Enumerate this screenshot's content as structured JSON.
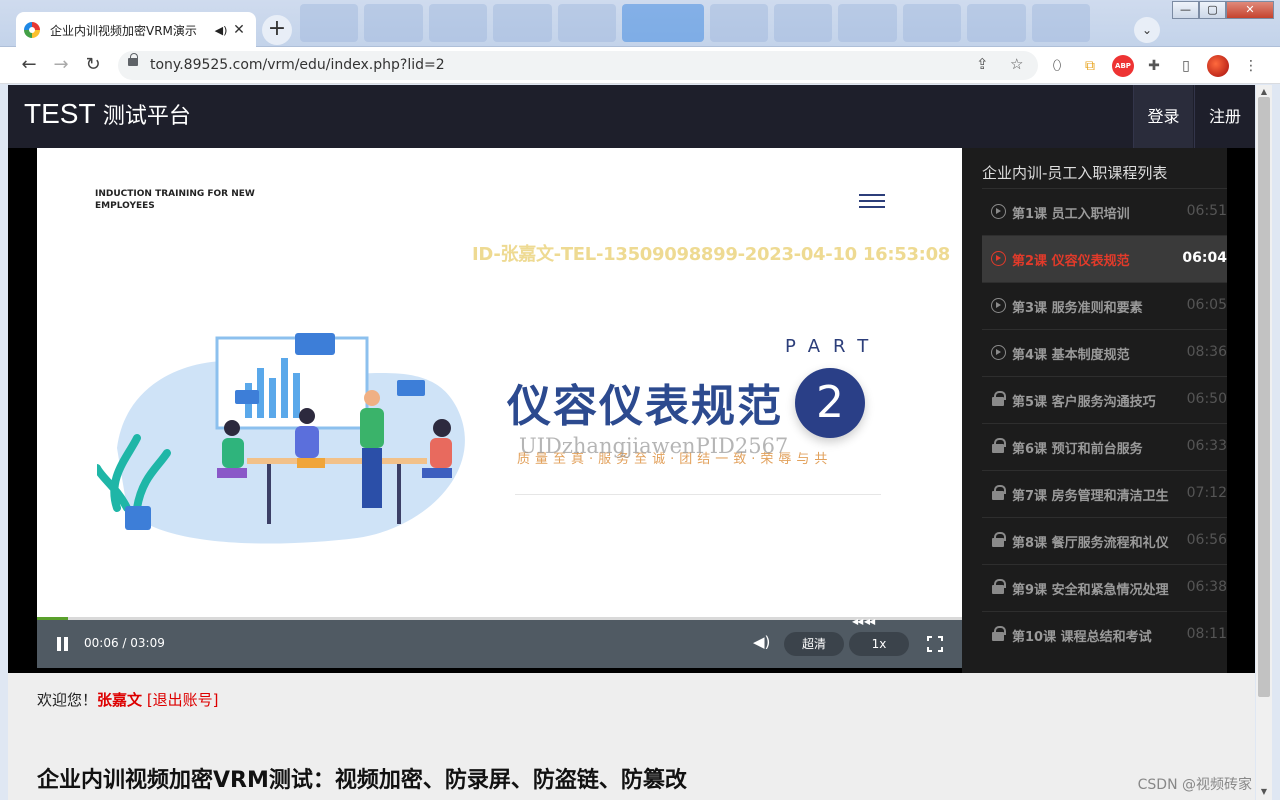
{
  "browser": {
    "tab_title": "企业内训视频加密VRM演示",
    "url": "tony.89525.com/vrm/edu/index.php?lid=2",
    "window_controls": [
      "—",
      "▢",
      "✕"
    ]
  },
  "site": {
    "logo_main": "TEST",
    "logo_sub": "测试平台",
    "login": "登录",
    "register": "注册"
  },
  "video": {
    "induction_text": "INDUCTION TRAINING FOR NEW EMPLOYEES",
    "watermark_top": "ID-张嘉文-TEL-13509098899-2023-04-10 16:53:08",
    "part_label": "PART",
    "slide_title": "仪容仪表规范",
    "part_number": "2",
    "watermark_mid": "UIDzhangjiawenPID2567",
    "motto": "质量至真·服务至诚·团结一致·荣辱与共",
    "progress_fraction": 0.033
  },
  "controls": {
    "time": "00:06 / 03:09",
    "quality": "超清",
    "speed": "1x"
  },
  "playlist": {
    "title": "企业内训-员工入职课程列表",
    "items": [
      {
        "name": "第1课 员工入职培训",
        "duration": "06:51"
      },
      {
        "name": "第2课 仪容仪表规范",
        "duration": "06:04"
      },
      {
        "name": "第3课 服务准则和要素",
        "duration": "06:05"
      },
      {
        "name": "第4课 基本制度规范",
        "duration": "08:36"
      },
      {
        "name": "第5课 客户服务沟通技巧",
        "duration": "06:50"
      },
      {
        "name": "第6课 预订和前台服务",
        "duration": "06:33"
      },
      {
        "name": "第7课 房务管理和清洁卫生",
        "duration": "07:12"
      },
      {
        "name": "第8课 餐厅服务流程和礼仪",
        "duration": "06:56"
      },
      {
        "name": "第9课 安全和紧急情况处理",
        "duration": "06:38"
      },
      {
        "name": "第10课 课程总结和考试",
        "duration": "08:11"
      }
    ]
  },
  "user": {
    "welcome": "欢迎您！",
    "name": "张嘉文",
    "logout": "[退出账号]"
  },
  "page_heading": "企业内训视频加密VRM测试：视频加密、防录屏、防盗链、防篡改",
  "csdn": "CSDN @视频砖家"
}
